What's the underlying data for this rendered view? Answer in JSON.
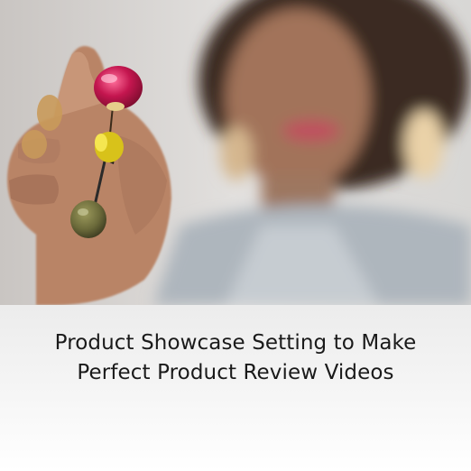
{
  "caption": {
    "line1": "Product Showcase Setting to Make",
    "line2": "Perfect Product Review Videos"
  },
  "photo": {
    "subject": "woman-holding-beaded-necklace"
  },
  "colors": {
    "caption_text": "#1a1a1a",
    "panel_top": "#ececec",
    "panel_bottom": "#ffffff",
    "bead_pink": "#c4164f",
    "bead_yellow": "#d8c21a",
    "bead_olive": "#6b6a3a"
  }
}
